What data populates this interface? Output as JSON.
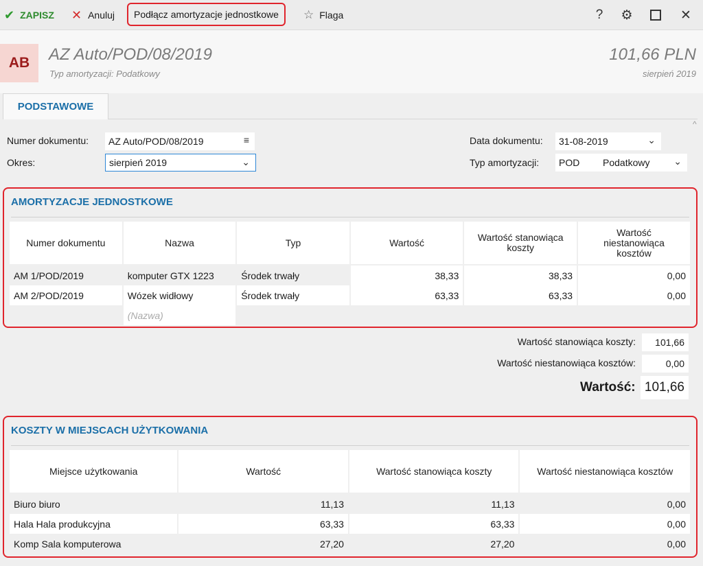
{
  "toolbar": {
    "save_label": "ZAPISZ",
    "cancel_label": "Anuluj",
    "connect_label": "Podłącz amortyzacje jednostkowe",
    "flag_label": "Flaga",
    "help_glyph": "?",
    "icons": [
      "checkmark-icon",
      "x-icon",
      "star-icon",
      "help-icon",
      "gear-icon",
      "maximize-icon",
      "close-icon"
    ]
  },
  "header": {
    "avatar_initials": "AB",
    "title": "AZ Auto/POD/08/2019",
    "subtitle": "Typ amortyzacji: Podatkowy",
    "amount": "101,66 PLN",
    "period": "sierpień 2019"
  },
  "tabs": [
    {
      "label": "PODSTAWOWE"
    }
  ],
  "form": {
    "doc_number_label": "Numer dokumentu:",
    "doc_number_value": "AZ Auto/POD/08/2019",
    "period_label": "Okres:",
    "period_value": "sierpień 2019",
    "doc_date_label": "Data dokumentu:",
    "doc_date_value": "31-08-2019",
    "dep_type_label": "Typ amortyzacji:",
    "dep_type_code": "POD",
    "dep_type_name": "Podatkowy"
  },
  "unit_section": {
    "title": "AMORTYZACJE JEDNOSTKOWE",
    "columns": [
      "Numer dokumentu",
      "Nazwa",
      "Typ",
      "Wartość",
      "Wartość stanowiąca koszty",
      "Wartość niestanowiąca kosztów"
    ],
    "rows": [
      [
        "AM 1/POD/2019",
        "komputer GTX 1223",
        "Środek trwały",
        "38,33",
        "38,33",
        "0,00"
      ],
      [
        "AM 2/POD/2019",
        "Wózek widłowy",
        "Środek trwały",
        "63,33",
        "63,33",
        "0,00"
      ]
    ],
    "new_row_placeholder": "(Nazwa)"
  },
  "totals": {
    "cost_label": "Wartość stanowiąca koszty:",
    "cost_value": "101,66",
    "noncost_label": "Wartość niestanowiąca kosztów:",
    "noncost_value": "0,00",
    "total_label": "Wartość:",
    "total_value": "101,66"
  },
  "cost_section": {
    "title": "KOSZTY W MIEJSCACH UŻYTKOWANIA",
    "columns": [
      "Miejsce użytkowania",
      "Wartość",
      "Wartość stanowiąca koszty",
      "Wartość niestanowiąca kosztów"
    ],
    "rows": [
      [
        "Biuro biuro",
        "11,13",
        "11,13",
        "0,00"
      ],
      [
        "Hala Hala produkcyjna",
        "63,33",
        "63,33",
        "0,00"
      ],
      [
        "Komp Sala komputerowa",
        "27,20",
        "27,20",
        "0,00"
      ]
    ]
  },
  "colors": {
    "accent": "#1b6fa8",
    "highlight_border": "#e0242c",
    "save_green": "#2e8b2e",
    "cancel_red": "#d42b2b",
    "avatar_bg": "#f6d6d2",
    "avatar_fg": "#9b1b1b"
  }
}
